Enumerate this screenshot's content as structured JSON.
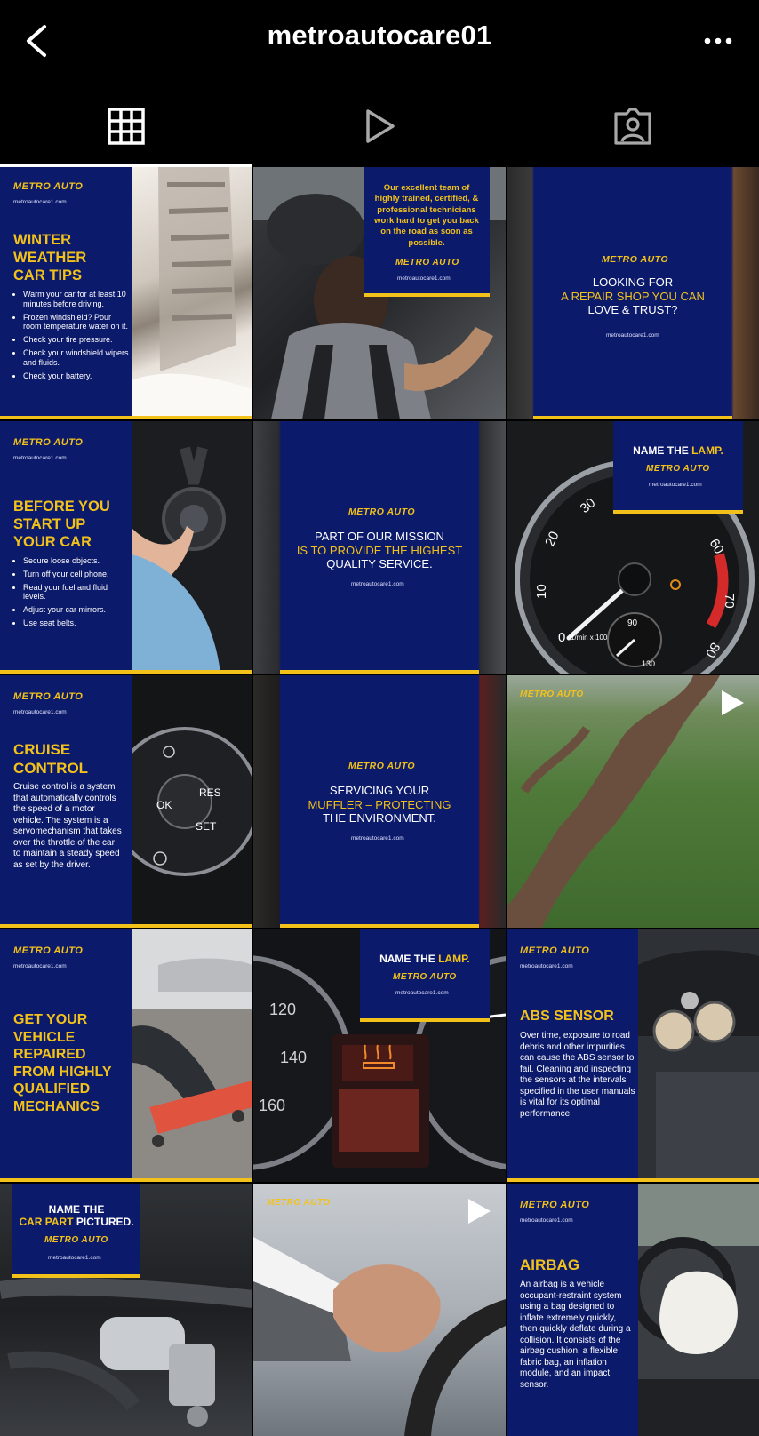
{
  "header": {
    "username": "metroautocare01"
  },
  "tabs": [
    {
      "name": "posts",
      "icon": "grid-icon",
      "active": true
    },
    {
      "name": "reels",
      "icon": "play-icon",
      "active": false
    },
    {
      "name": "tagged",
      "icon": "tagged-person-icon",
      "active": false
    }
  ],
  "brand": {
    "logo": "METRO AUTO",
    "site": "metroautocare1.com",
    "navy": "#0c1a6b",
    "yellow": "#f2c21b"
  },
  "posts": {
    "winter": {
      "heading": "WINTER WEATHER CAR TIPS",
      "tips": [
        "Warm your car for at least 10 minutes before driving.",
        "Frozen windshield? Pour room temperature water on it.",
        "Check your tire pressure.",
        "Check your windshield wipers and fluids.",
        "Check your battery."
      ]
    },
    "team": {
      "text": "Our excellent team of highly trained, certified, & professional technicians work hard to get you back on the road as soon as possible."
    },
    "repair_shop": {
      "line1": "LOOKING FOR",
      "line2": "A REPAIR SHOP YOU CAN",
      "line3": "LOVE & TRUST?"
    },
    "before_start": {
      "heading": "BEFORE YOU START UP YOUR CAR",
      "tips": [
        "Secure loose objects.",
        "Turn off your cell phone.",
        "Read your fuel and fluid levels.",
        "Adjust your car mirrors.",
        "Use seat belts."
      ]
    },
    "mission": {
      "line1": "PART OF OUR MISSION",
      "line2": "IS TO PROVIDE THE HIGHEST",
      "line3": "QUALITY SERVICE."
    },
    "lamp1": {
      "title_a": "NAME THE ",
      "title_b": "LAMP."
    },
    "cruise": {
      "heading": "CRUISE CONTROL",
      "body": "Cruise control is a system that automatically controls the speed of a motor vehicle. The system is a servomechanism that takes over the throttle of the car to maintain a steady speed as set by the driver."
    },
    "muffler": {
      "line1": "SERVICING YOUR",
      "line2": "MUFFLER – PROTECTING",
      "line3": "THE ENVIRONMENT."
    },
    "repaired": {
      "heading": "GET YOUR VEHICLE REPAIRED FROM HIGHLY QUALIFIED MECHANICS"
    },
    "lamp2": {
      "title_a": "NAME THE ",
      "title_b": "LAMP."
    },
    "abs": {
      "heading": "ABS SENSOR",
      "body": "Over time, exposure to road debris and other impurities can cause the ABS sensor to fail. Cleaning and inspecting the sensors at the intervals specified in the user manuals is vital for its optimal performance."
    },
    "car_part": {
      "line1": "NAME THE",
      "line2a": "CAR PART",
      "line2b": " PICTURED."
    },
    "airbag": {
      "heading": "AIRBAG",
      "body": "An airbag is a vehicle occupant-restraint system using a bag designed to inflate extremely quickly, then quickly deflate during a collision. It consists of the airbag cushion, a flexible fabric bag, an inflation module, and an impact sensor."
    },
    "gauge_numbers": [
      "30",
      "20",
      "10",
      "0",
      "60",
      "70",
      "80",
      "90",
      "130"
    ],
    "gauge_unit": "1/min x 100",
    "cruise_buttons": [
      "OK",
      "RES",
      "SET"
    ],
    "speed_numbers": [
      "120",
      "140",
      "160"
    ]
  }
}
